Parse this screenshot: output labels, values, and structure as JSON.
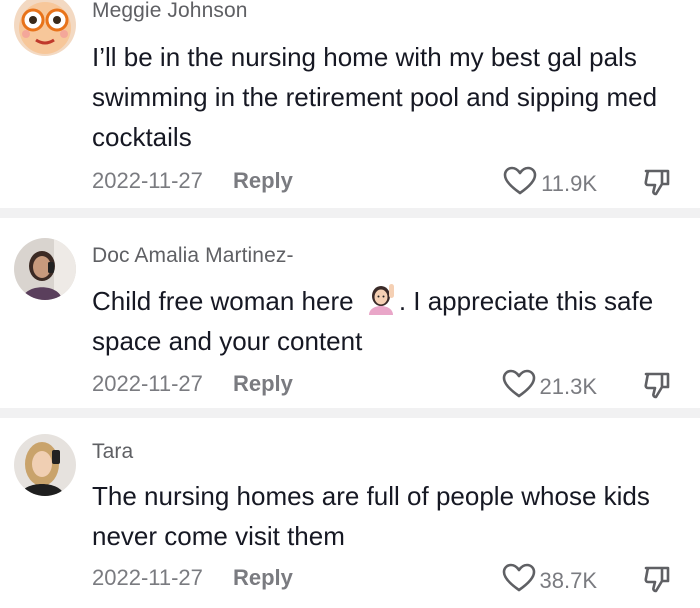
{
  "comments": [
    {
      "username": "Meggie Johnson",
      "text": "I’ll be in the nursing home with my best gal pals swimming in the retirement pool and sipping med cocktails",
      "date": "2022-11-27",
      "reply_label": "Reply",
      "likes": "11.9K"
    },
    {
      "username": "Doc Amalia Martinez-",
      "text_before_emoji": "Child free woman here ",
      "emoji": "raising-hand-emoji",
      "text_after_emoji": ". I appreciate this safe space and your content",
      "date": "2022-11-27",
      "reply_label": "Reply",
      "likes": "21.3K"
    },
    {
      "username": "Tara",
      "text": "The nursing homes are full of people whose kids never come visit them",
      "date": "2022-11-27",
      "reply_label": "Reply",
      "likes": "38.7K"
    }
  ],
  "icons": {
    "like": "heart-outline-icon",
    "dislike": "thumbs-down-outline-icon"
  },
  "colors": {
    "text": "#161823",
    "muted": "#7a7b80",
    "divider": "#f1f1f2"
  }
}
